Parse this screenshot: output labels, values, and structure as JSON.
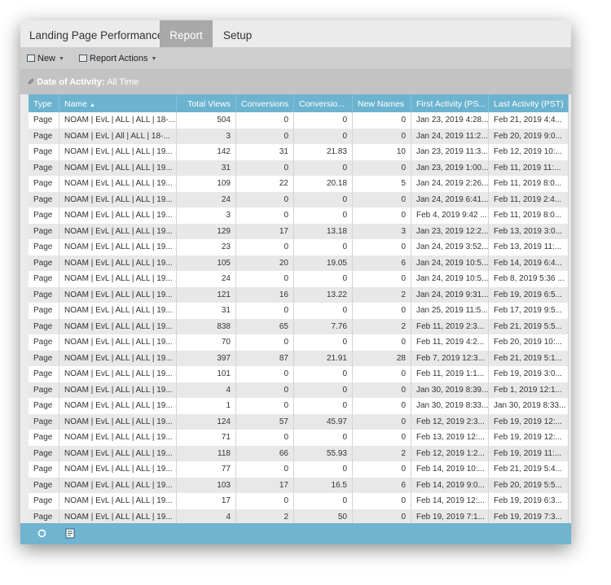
{
  "tabs": [
    {
      "label": "Landing Page Performance"
    },
    {
      "label": "Report"
    },
    {
      "label": "Setup"
    }
  ],
  "toolbar": {
    "new_label": "New",
    "report_actions_label": "Report Actions"
  },
  "filter": {
    "label": "Date of Activity:",
    "value": "All Time"
  },
  "table": {
    "columns": [
      "Type",
      "Name",
      "Total Views",
      "Conversions",
      "Conversio...",
      "New Names",
      "First Activity (PS...",
      "Last Activity (PST)"
    ],
    "rows": [
      [
        "Page",
        "NOAM | EvL | ALL | ALL | 18-...",
        "504",
        "0",
        "0",
        "0",
        "Jan 23, 2019 4:28...",
        "Feb 21, 2019 4:4..."
      ],
      [
        "Page",
        "NOAM | EvL | All | ALL | 18-...",
        "3",
        "0",
        "0",
        "0",
        "Jan 24, 2019 11:2...",
        "Feb 20, 2019 9:0..."
      ],
      [
        "Page",
        "NOAM | EvL | ALL | ALL | 19...",
        "142",
        "31",
        "21.83",
        "10",
        "Jan 23, 2019 11:3...",
        "Feb 12, 2019 10:..."
      ],
      [
        "Page",
        "NOAM | EvL | ALL | ALL | 19...",
        "31",
        "0",
        "0",
        "0",
        "Jan 23, 2019 1:00...",
        "Feb 11, 2019 11:..."
      ],
      [
        "Page",
        "NOAM | EvL | ALL | ALL | 19...",
        "109",
        "22",
        "20.18",
        "5",
        "Jan 24, 2019 2:26...",
        "Feb 11, 2019 8:0..."
      ],
      [
        "Page",
        "NOAM | EvL | ALL | ALL | 19...",
        "24",
        "0",
        "0",
        "0",
        "Jan 24, 2019 6:41...",
        "Feb 11, 2019 2:4..."
      ],
      [
        "Page",
        "NOAM | EvL | ALL | ALL | 19...",
        "3",
        "0",
        "0",
        "0",
        "Feb 4, 2019 9:42 ...",
        "Feb 11, 2019 8:0..."
      ],
      [
        "Page",
        "NOAM | EvL | ALL | ALL | 19...",
        "129",
        "17",
        "13.18",
        "3",
        "Jan 23, 2019 12:2...",
        "Feb 13, 2019 3:0..."
      ],
      [
        "Page",
        "NOAM | EvL | ALL | ALL | 19...",
        "23",
        "0",
        "0",
        "0",
        "Jan 24, 2019 3:52...",
        "Feb 13, 2019 11:..."
      ],
      [
        "Page",
        "NOAM | EvL | ALL | ALL | 19...",
        "105",
        "20",
        "19.05",
        "6",
        "Jan 24, 2019 10:5...",
        "Feb 14, 2019 6:4..."
      ],
      [
        "Page",
        "NOAM | EvL | ALL | ALL | 19...",
        "24",
        "0",
        "0",
        "0",
        "Jan 24, 2019 10:5...",
        "Feb 8, 2019 5:36 ..."
      ],
      [
        "Page",
        "NOAM | EvL | ALL | ALL | 19...",
        "121",
        "16",
        "13.22",
        "2",
        "Jan 24, 2019 9:31...",
        "Feb 19, 2019 6:5..."
      ],
      [
        "Page",
        "NOAM | EvL | ALL | ALL | 19...",
        "31",
        "0",
        "0",
        "0",
        "Jan 25, 2019 11:5...",
        "Feb 17, 2019 9:5..."
      ],
      [
        "Page",
        "NOAM | EvL | ALL | ALL | 19...",
        "838",
        "65",
        "7.76",
        "2",
        "Feb 11, 2019 2:3...",
        "Feb 21, 2019 5:5..."
      ],
      [
        "Page",
        "NOAM | EvL | ALL | ALL | 19...",
        "70",
        "0",
        "0",
        "0",
        "Feb 11, 2019 4:2...",
        "Feb 20, 2019 10:..."
      ],
      [
        "Page",
        "NOAM | EvL | ALL | ALL | 19...",
        "397",
        "87",
        "21.91",
        "28",
        "Feb 7, 2019 12:3...",
        "Feb 21, 2019 5:1..."
      ],
      [
        "Page",
        "NOAM | EvL | ALL | ALL | 19...",
        "101",
        "0",
        "0",
        "0",
        "Feb 11, 2019 1:1...",
        "Feb 19, 2019 3:0..."
      ],
      [
        "Page",
        "NOAM | EvL | ALL | ALL | 19...",
        "4",
        "0",
        "0",
        "0",
        "Jan 30, 2019 8:39...",
        "Feb 1, 2019 12:1..."
      ],
      [
        "Page",
        "NOAM | EvL | ALL | ALL | 19...",
        "1",
        "0",
        "0",
        "0",
        "Jan 30, 2019 8:33...",
        "Jan 30, 2019 8:33..."
      ],
      [
        "Page",
        "NOAM | EvL | ALL | ALL | 19...",
        "124",
        "57",
        "45.97",
        "0",
        "Feb 12, 2019 2:3...",
        "Feb 19, 2019 12:..."
      ],
      [
        "Page",
        "NOAM | EvL | ALL | ALL | 19...",
        "71",
        "0",
        "0",
        "0",
        "Feb 13, 2019 12:...",
        "Feb 19, 2019 12:..."
      ],
      [
        "Page",
        "NOAM | EvL | ALL | ALL | 19...",
        "118",
        "66",
        "55.93",
        "2",
        "Feb 12, 2019 1:2...",
        "Feb 19, 2019 11:..."
      ],
      [
        "Page",
        "NOAM | EvL | ALL | ALL | 19...",
        "77",
        "0",
        "0",
        "0",
        "Feb 14, 2019 10:...",
        "Feb 21, 2019 5:4..."
      ],
      [
        "Page",
        "NOAM | EvL | ALL | ALL | 19...",
        "103",
        "17",
        "16.5",
        "6",
        "Feb 14, 2019 9:0...",
        "Feb 20, 2019 5:5..."
      ],
      [
        "Page",
        "NOAM | EvL | ALL | ALL | 19...",
        "17",
        "0",
        "0",
        "0",
        "Feb 14, 2019 12:...",
        "Feb 19, 2019 6:3..."
      ],
      [
        "Page",
        "NOAM | EvL | ALL | ALL | 19...",
        "4",
        "2",
        "50",
        "0",
        "Feb 19, 2019 7:1...",
        "Feb 19, 2019 7:3..."
      ]
    ]
  },
  "colors": {
    "header_blue": "#6cb3cf",
    "footer_blue": "#70b4cf",
    "active_tab": "#a9a9a9"
  },
  "icons": {
    "sort_name": "sort-asc-icon",
    "refresh": "refresh-icon",
    "export": "export-icon"
  }
}
